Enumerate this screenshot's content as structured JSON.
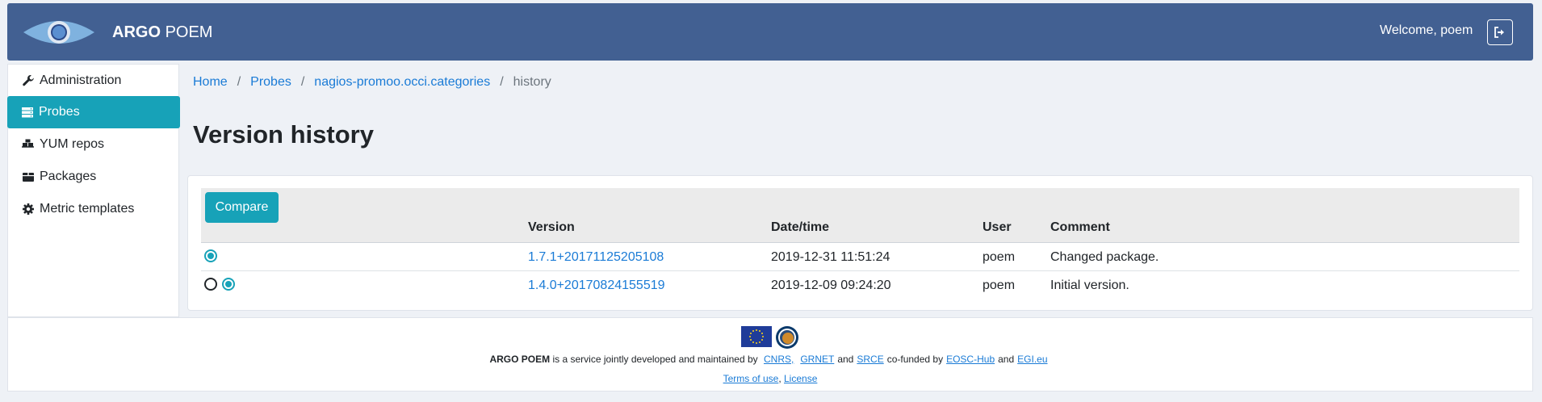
{
  "header": {
    "brand_bold": "ARGO",
    "brand_rest": "POEM",
    "welcome": "Welcome, poem"
  },
  "sidebar": {
    "items": [
      {
        "label": "Administration",
        "icon": "wrench-icon"
      },
      {
        "label": "Probes",
        "icon": "server-icon",
        "active": true
      },
      {
        "label": "YUM repos",
        "icon": "boxes-icon"
      },
      {
        "label": "Packages",
        "icon": "box-icon"
      },
      {
        "label": "Metric templates",
        "icon": "gear-icon"
      }
    ]
  },
  "breadcrumb": {
    "items": [
      "Home",
      "Probes",
      "nagios-promoo.occi.categories"
    ],
    "current": "history",
    "separator": "/"
  },
  "page": {
    "title": "Version history"
  },
  "table": {
    "compare_label": "Compare",
    "columns": [
      "Version",
      "Date/time",
      "User",
      "Comment"
    ],
    "rows": [
      {
        "version": "1.7.1+20171125205108",
        "datetime": "2019-12-31 11:51:24",
        "user": "poem",
        "comment": "Changed package."
      },
      {
        "version": "1.4.0+20170824155519",
        "datetime": "2019-12-09 09:24:20",
        "user": "poem",
        "comment": "Initial version."
      }
    ]
  },
  "footer": {
    "brand": "ARGO POEM",
    "text1": "is a service jointly developed and maintained by",
    "partners": [
      "CNRS,",
      "GRNET",
      "SRCE"
    ],
    "and1": "and",
    "cofunded": "co-funded by",
    "funders": [
      "EOSC-Hub",
      "EGI.eu"
    ],
    "and2": "and",
    "terms": "Terms of use",
    "comma": ",",
    "license": "License"
  },
  "colors": {
    "header": "#426092",
    "accent": "#17a2b8",
    "link": "#1a7bd6"
  }
}
